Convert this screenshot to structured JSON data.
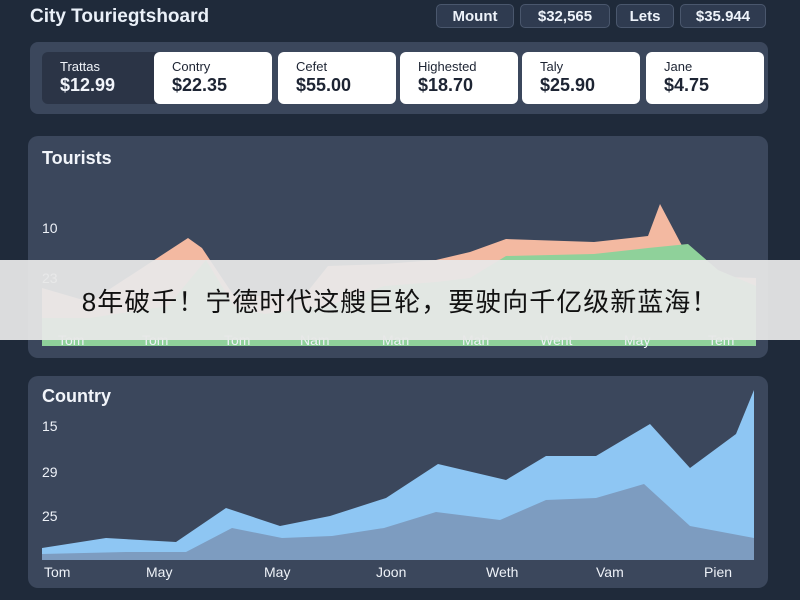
{
  "app": {
    "title": "City Touriegtshoard"
  },
  "top_chips": [
    "Mount",
    "$32,565",
    "Lets",
    "$35.944"
  ],
  "kpis": [
    {
      "label": "Trattas",
      "value": "$12.99",
      "active": true
    },
    {
      "label": "Contry",
      "value": "$22.35",
      "active": false
    },
    {
      "label": "Cefet",
      "value": "$55.00",
      "active": false
    },
    {
      "label": "Highested",
      "value": "$18.70",
      "active": false
    },
    {
      "label": "Taly",
      "value": "$25.90",
      "active": false
    },
    {
      "label": "Jane",
      "value": "$4.75",
      "active": false
    }
  ],
  "tourists_chart": {
    "title": "Tourists",
    "y_ticks": [
      "10",
      "23"
    ],
    "x_ticks": [
      "Tom",
      "Tom",
      "Tom",
      "Nam",
      "Man",
      "Mah",
      "Went",
      "May",
      "Tem"
    ],
    "colors": {
      "orange": "#f3b9a1",
      "green": "#8fd19a"
    }
  },
  "country_chart": {
    "title": "Country",
    "y_ticks": [
      "15",
      "29",
      "25"
    ],
    "x_ticks": [
      "Tom",
      "May",
      "May",
      "Joon",
      "Weth",
      "Vam",
      "Pien"
    ],
    "colors": {
      "light": "#8ec6f3",
      "dark": "#7d9cc0"
    }
  },
  "banner": {
    "text": "8年破千！宁德时代这艘巨轮，要驶向千亿级新蓝海！"
  }
}
